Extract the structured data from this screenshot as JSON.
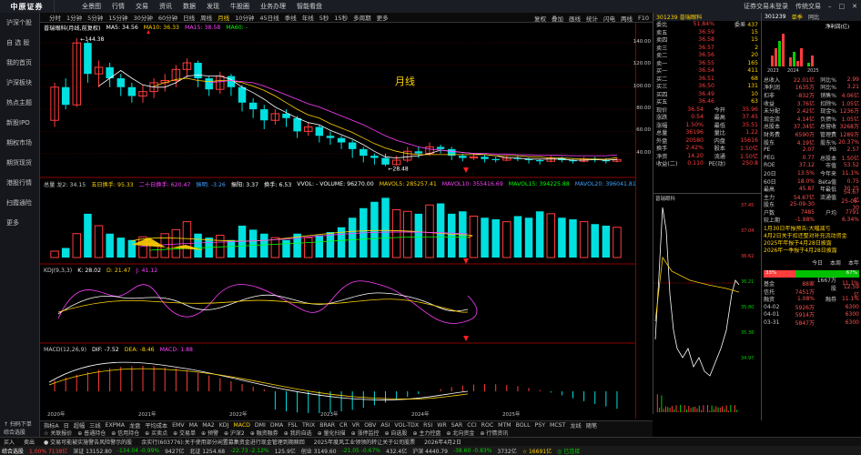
{
  "topbar": {
    "logo": "中原证券",
    "menu": [
      "全景图",
      "行情",
      "交易",
      "资讯",
      "数据",
      "发现",
      "牛股圈",
      "业务办理",
      "智能看盘"
    ],
    "right": [
      "证券交易未登录",
      "传统交易"
    ]
  },
  "sidebar": [
    "沪深个股",
    "自 选 股",
    "我的首页",
    "沪深板块",
    "热点主题",
    "新股IPO",
    "期权市场",
    "期货现货",
    "港股行情",
    "扫霞通险",
    "更多"
  ],
  "toolbar": {
    "periods": [
      "分时",
      "1分钟",
      "5分钟",
      "15分钟",
      "30分钟",
      "60分钟",
      "日线",
      "周线",
      "月线",
      "10分钟",
      "45日线",
      "季线",
      "年线",
      "5秒",
      "15秒",
      "多周期",
      "更多"
    ],
    "selected_period": "月线",
    "right": [
      "复权",
      "叠加",
      "画线",
      "统计",
      "闪电",
      "两线",
      "F10"
    ]
  },
  "chart_header": {
    "title": "普瑞眼科(月线,前复权)",
    "ma_items": [
      {
        "text": "MA5: 34.56",
        "color": "#ffffff"
      },
      {
        "text": "MA10: 36.33",
        "color": "#ffd200"
      },
      {
        "text": "MA15: 38.58",
        "color": "#ff40ff"
      },
      {
        "text": "MA60: -",
        "color": "#00ff00"
      }
    ],
    "high_label": "144.38",
    "low_label": "28.48",
    "period_label": "月线"
  },
  "vol_legend": {
    "items": [
      {
        "text": "总量 龙2: 34.15",
        "color": "#c8c8c8"
      },
      {
        "text": "五日换手: 95.33",
        "color": "#ffd200"
      },
      {
        "text": "二十日换手: 620.47",
        "color": "#ff40ff"
      },
      {
        "text": "振明: -3.26",
        "color": "#40a0ff"
      },
      {
        "text": "振阳: 3.37",
        "color": "#ffffff"
      },
      {
        "text": "换手: 6.53",
        "color": "#ffffff"
      },
      {
        "text": "VVOL: - VOLUME: 96270.00",
        "color": "#ffffff"
      },
      {
        "text": "MAVOL5: 285257.41",
        "color": "#ffd200"
      },
      {
        "text": "MAVOL10: 355416.69",
        "color": "#ff40ff"
      },
      {
        "text": "MAVOL15: 394225.88",
        "color": "#00ff00"
      },
      {
        "text": "MAVOL20: 396041.81",
        "color": "#40a0ff"
      },
      {
        "text": "MAV",
        "color": "#ffffff"
      }
    ]
  },
  "kdj_legend": {
    "items": [
      {
        "text": "KDJ(9,3,3)",
        "color": "#c8c8c8"
      },
      {
        "text": "K: 28.02",
        "color": "#ffffff"
      },
      {
        "text": "D: 21.47",
        "color": "#ffd200"
      },
      {
        "text": "J: 41.12",
        "color": "#ff40ff"
      }
    ]
  },
  "macd_legend": {
    "items": [
      {
        "text": "MACD(12,26,9)",
        "color": "#c8c8c8"
      },
      {
        "text": "DIF: -7.52",
        "color": "#ffffff"
      },
      {
        "text": "DEA: -8.46",
        "color": "#ffd200"
      },
      {
        "text": "MACD: 1.88",
        "color": "#ff40ff"
      }
    ]
  },
  "price_axis": [
    "140.00",
    "120.00",
    "100.00",
    "80.00",
    "60.00",
    "40.00"
  ],
  "date_labels": [
    "2020年",
    "2021年",
    "2022年",
    "2023年",
    "2024年",
    "2025年"
  ],
  "chart_data": {
    "type": "candlestick",
    "ylim": [
      20,
      150
    ],
    "candles": [
      [
        70,
        100,
        64,
        104
      ],
      [
        100,
        84,
        80,
        108
      ],
      [
        84,
        140,
        82,
        144.38
      ],
      [
        140,
        112,
        104,
        142
      ],
      [
        112,
        118,
        100,
        124
      ],
      [
        118,
        108,
        100,
        122
      ],
      [
        108,
        100,
        92,
        112
      ],
      [
        100,
        92,
        86,
        104
      ],
      [
        92,
        96,
        86,
        102
      ],
      [
        96,
        104,
        90,
        108
      ],
      [
        104,
        106,
        96,
        112
      ],
      [
        106,
        116,
        100,
        120
      ],
      [
        116,
        122,
        108,
        126
      ],
      [
        122,
        108,
        100,
        124
      ],
      [
        108,
        98,
        92,
        110
      ],
      [
        98,
        110,
        94,
        114
      ],
      [
        110,
        100,
        92,
        112
      ],
      [
        100,
        86,
        78,
        102
      ],
      [
        86,
        80,
        72,
        90
      ],
      [
        80,
        70,
        62,
        84
      ],
      [
        70,
        76,
        66,
        80
      ],
      [
        76,
        72,
        64,
        80
      ],
      [
        72,
        60,
        54,
        74
      ],
      [
        60,
        64,
        56,
        68
      ],
      [
        64,
        56,
        50,
        66
      ],
      [
        56,
        54,
        48,
        60
      ],
      [
        54,
        50,
        44,
        56
      ],
      [
        50,
        44,
        36,
        52
      ],
      [
        44,
        38,
        32,
        46
      ],
      [
        38,
        36,
        30,
        40
      ],
      [
        36,
        30,
        28.48,
        40
      ],
      [
        30,
        34,
        29,
        38
      ],
      [
        34,
        42,
        32,
        46
      ],
      [
        42,
        40,
        36,
        46
      ],
      [
        40,
        46,
        38,
        50
      ],
      [
        46,
        44,
        40,
        48
      ],
      [
        44,
        38,
        34,
        46
      ],
      [
        38,
        36,
        33,
        40
      ],
      [
        36,
        37,
        34,
        40
      ],
      [
        37,
        35,
        32,
        39
      ],
      [
        35,
        34,
        32,
        37
      ],
      [
        34,
        36,
        33,
        38
      ],
      [
        36,
        35,
        33,
        38
      ],
      [
        35,
        34,
        31,
        36
      ],
      [
        34,
        33,
        30,
        35
      ],
      [
        33,
        36,
        32,
        38
      ],
      [
        36,
        34,
        32,
        37
      ],
      [
        34,
        33,
        31,
        35
      ],
      [
        33,
        35,
        32,
        37
      ],
      [
        35,
        34,
        32,
        37
      ],
      [
        34,
        33,
        31,
        36
      ],
      [
        33,
        34.56,
        32,
        36
      ]
    ],
    "ma5": [
      null,
      null,
      null,
      null,
      101,
      108,
      115,
      108,
      102,
      100,
      100,
      104,
      110,
      111,
      110,
      110,
      107,
      100,
      95,
      89,
      82,
      77,
      72,
      68,
      66,
      61,
      57,
      53,
      48,
      42,
      37,
      36,
      37,
      38,
      40,
      43,
      42,
      41,
      40,
      39,
      38,
      36,
      36,
      35,
      35,
      35,
      35,
      34,
      34,
      34.5,
      34,
      34.56
    ],
    "ma10": [
      null,
      null,
      null,
      null,
      null,
      null,
      null,
      null,
      null,
      101,
      104,
      107,
      108,
      106,
      105,
      106,
      106,
      104,
      101,
      97,
      92,
      86,
      80,
      75,
      72,
      67,
      63,
      59,
      54,
      49,
      45,
      42,
      40,
      39,
      39,
      39,
      39,
      39,
      39,
      39,
      38,
      38,
      38,
      37,
      37,
      36,
      36,
      35.5,
      35,
      35,
      34.8,
      36.33
    ],
    "ma15": [
      null,
      null,
      null,
      null,
      null,
      null,
      null,
      null,
      null,
      null,
      null,
      null,
      null,
      null,
      104,
      105,
      106,
      105,
      104,
      101,
      97,
      93,
      89,
      85,
      82,
      78,
      74,
      70,
      66,
      61,
      56,
      52,
      49,
      46,
      44,
      43,
      42,
      41,
      40,
      40,
      39.5,
      39.5,
      39,
      38.8,
      38.6,
      38.5,
      38.3,
      38,
      38,
      38,
      38,
      38.58
    ]
  }
}
